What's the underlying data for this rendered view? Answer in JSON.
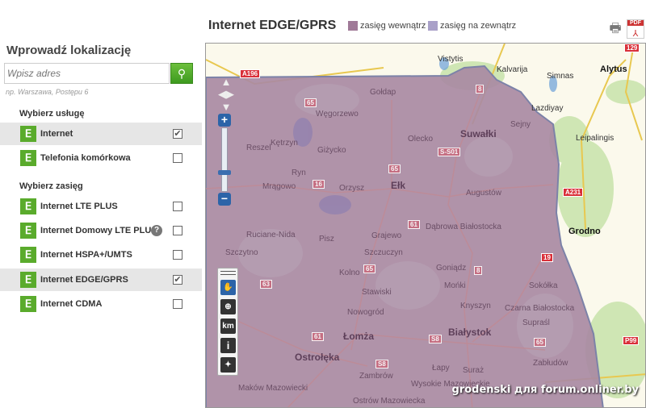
{
  "sidebar": {
    "heading": "Wprowadź lokalizację",
    "search_placeholder": "Wpisz adres",
    "search_icon": "search-icon",
    "hint": "np. Warszawa, Postępu 6",
    "service_heading": "Wybierz usługę",
    "services": [
      {
        "label": "Internet",
        "checked": true
      },
      {
        "label": "Telefonia komórkowa",
        "checked": false
      }
    ],
    "range_heading": "Wybierz zasięg",
    "ranges": [
      {
        "label": "Internet LTE PLUS",
        "checked": false
      },
      {
        "label": "Internet Domowy LTE PLUS",
        "checked": false,
        "help": "?"
      },
      {
        "label": "Internet HSPA+/UMTS",
        "checked": false
      },
      {
        "label": "Internet EDGE/GPRS",
        "checked": true
      },
      {
        "label": "Internet CDMA",
        "checked": false
      }
    ]
  },
  "header": {
    "title": "Internet EDGE/GPRS",
    "legend": [
      {
        "label": "zasięg wewnątrz",
        "color": "#a07a98"
      },
      {
        "label": "zasięg na zewnątrz",
        "color": "#a9a0c8"
      }
    ],
    "print_icon": "printer-icon",
    "pdf_icon": "pdf-icon",
    "pdf_label": "PDF"
  },
  "map": {
    "places": [
      "Vistytis",
      "Kalvarija",
      "Simnas",
      "Alytus",
      "Gołdap",
      "Węgorzewo",
      "Lazdiyay",
      "Sejny",
      "Suwałki",
      "Olecko",
      "Kętrzyn",
      "Reszel",
      "Giżycko",
      "Leipalingis",
      "Ryn",
      "Mrągowo",
      "Orzysz",
      "Ełk",
      "Augustów",
      "Grodno",
      "Ruciane-Nida",
      "Pisz",
      "Grajewo",
      "Dąbrowa Białostocka",
      "Szczytno",
      "Szczuczyn",
      "Goniądz",
      "Kolno",
      "Stawiski",
      "Mońki",
      "Sokółka",
      "Knyszyn",
      "Czarna Białostocka",
      "Nowogród",
      "Supraśl",
      "Białystok",
      "Łomża",
      "Ostrołęka",
      "Zabłudów",
      "Łapy",
      "Suraż",
      "Zambrów",
      "Wysokie Mazowieckie",
      "Maków Mazowiecki",
      "Ostrów Mazowiecka"
    ],
    "roads": [
      "A196",
      "65",
      "8",
      "S-S01",
      "65",
      "16",
      "A231",
      "129",
      "61",
      "65",
      "63",
      "8",
      "19",
      "61",
      "S8",
      "65",
      "P99",
      "S8"
    ],
    "zoom_in": "+",
    "zoom_out": "−",
    "tools": [
      "pan",
      "zoom-box",
      "km",
      "i",
      "fullscreen"
    ],
    "watermark": "grodenski для forum.onliner.by"
  }
}
